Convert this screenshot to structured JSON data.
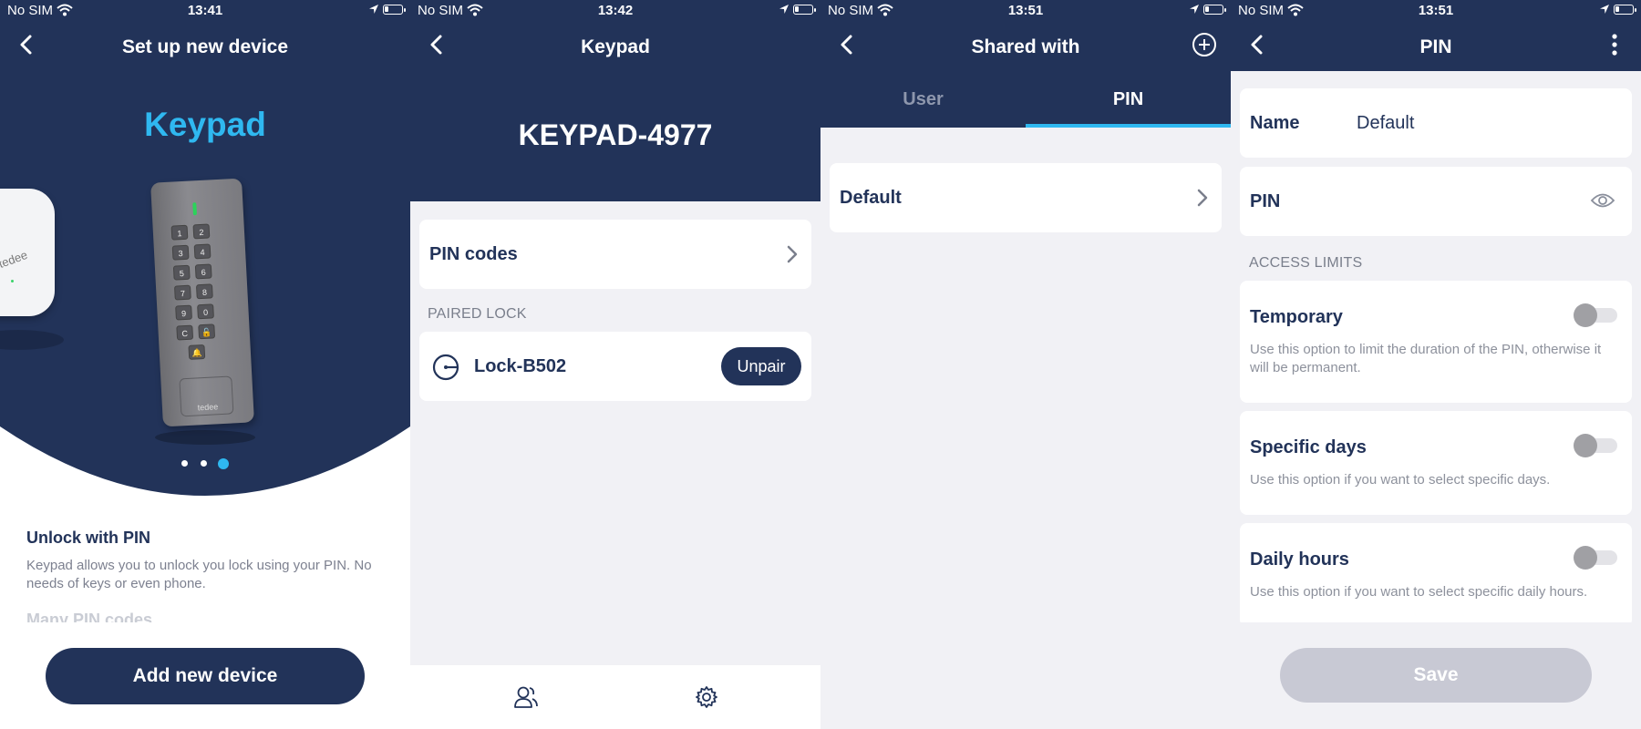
{
  "status_bars": [
    {
      "carrier": "No SIM",
      "time": "13:41"
    },
    {
      "carrier": "No SIM",
      "time": "13:42"
    },
    {
      "carrier": "No SIM",
      "time": "13:51"
    },
    {
      "carrier": "No SIM",
      "time": "13:51"
    }
  ],
  "colors": {
    "navy": "#223359",
    "accent": "#2fb8f0",
    "background": "#f1f1f5",
    "disabled": "#c8c9d4"
  },
  "setup": {
    "title": "Set up new device",
    "product_name": "Keypad",
    "carousel": {
      "count": 3,
      "active": 3
    },
    "heading": "Unlock with PIN",
    "description": "Keypad allows you to unlock you lock using your PIN. No needs of keys or even phone.",
    "next_heading": "Many PIN codes",
    "device_brand": "tedee",
    "keypad_keys": [
      "1",
      "2",
      "3",
      "4",
      "5",
      "6",
      "7",
      "8",
      "9",
      "0",
      "C",
      "🔓",
      "🔔"
    ],
    "add_button": "Add new device",
    "icons": {
      "back": "back-arrow-icon",
      "keypad": "keypad-device-image",
      "lock": "smart-lock-image"
    }
  },
  "keypad": {
    "title": "Keypad",
    "device_name": "KEYPAD-4977",
    "pin_codes_label": "PIN codes",
    "paired_lock_label": "PAIRED LOCK",
    "lock_name": "Lock-B502",
    "unpair_label": "Unpair",
    "icons": {
      "back": "back-arrow-icon",
      "chevron": "chevron-right-icon",
      "lock": "lock-icon",
      "users": "users-icon",
      "settings": "gear-icon"
    }
  },
  "shared": {
    "title": "Shared with",
    "tabs": [
      {
        "label": "User",
        "active": false
      },
      {
        "label": "PIN",
        "active": true
      }
    ],
    "items": [
      {
        "label": "Default"
      }
    ],
    "icons": {
      "back": "back-arrow-icon",
      "add": "plus-circle-icon",
      "chevron": "chevron-right-icon"
    }
  },
  "pin": {
    "title": "PIN",
    "name_label": "Name",
    "name_value": "Default",
    "pin_label": "PIN",
    "access_limits_label": "ACCESS LIMITS",
    "options": [
      {
        "label": "Temporary",
        "description": "Use this option to limit the duration of the PIN, otherwise it will be permanent.",
        "enabled": false
      },
      {
        "label": "Specific days",
        "description": "Use this option if you want to select specific days.",
        "enabled": false
      },
      {
        "label": "Daily hours",
        "description": "Use this option if you want to select specific daily hours.",
        "enabled": false
      }
    ],
    "save_label": "Save",
    "icons": {
      "back": "back-arrow-icon",
      "more": "more-vertical-icon",
      "eye": "eye-icon"
    }
  }
}
